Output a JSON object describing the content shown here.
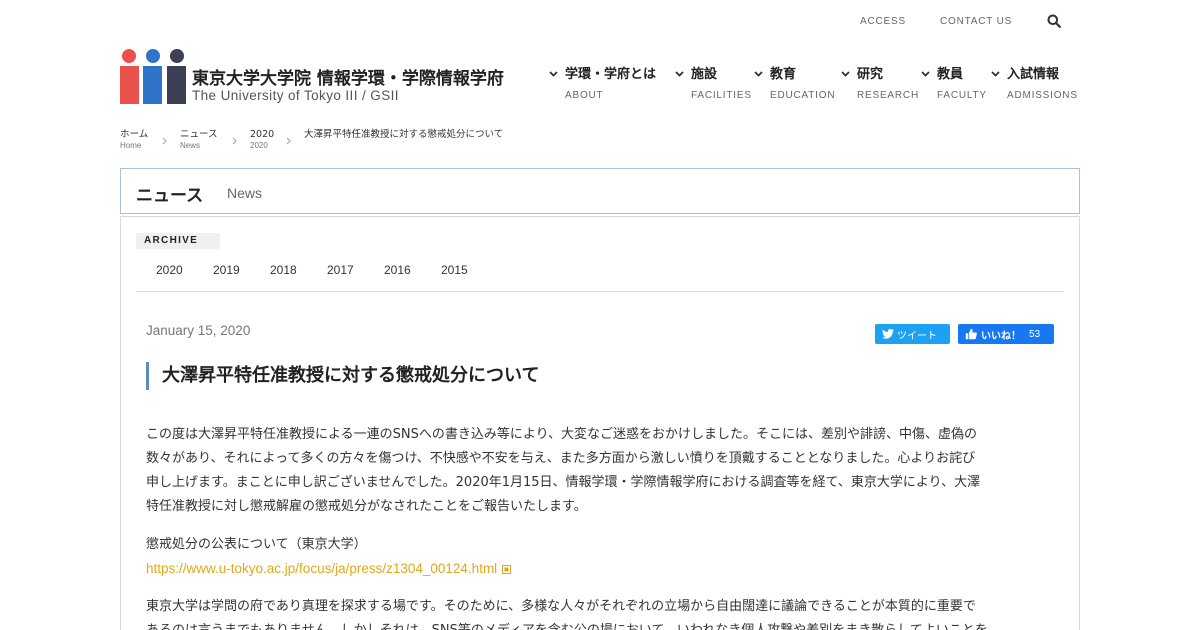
{
  "header": {
    "links": {
      "access": "ACCESS",
      "contact": "CONTACT US"
    },
    "site_title": "東京大学大学院 情報学環・学際情報学府",
    "site_subtitle": "The University of Tokyo III / GSII",
    "logo_colors": [
      "#e8524a",
      "#2e74c9",
      "#3d3f55"
    ]
  },
  "nav": [
    {
      "jp": "学環・学府とは",
      "en": "ABOUT"
    },
    {
      "jp": "施設",
      "en": "FACILITIES"
    },
    {
      "jp": "教育",
      "en": "EDUCATION"
    },
    {
      "jp": "研究",
      "en": "RESEARCH"
    },
    {
      "jp": "教員",
      "en": "FACULTY"
    },
    {
      "jp": "入試情報",
      "en": "ADMISSIONS"
    }
  ],
  "breadcrumb": [
    {
      "jp": "ホーム",
      "en": "Home"
    },
    {
      "jp": "ニュース",
      "en": "News"
    },
    {
      "jp": "2020",
      "en": "2020"
    },
    {
      "jp": "大澤昇平特任准教授に対する懲戒処分について",
      "en": ""
    }
  ],
  "section": {
    "title_jp": "ニュース",
    "title_en": "News"
  },
  "archive": {
    "label": "ARCHIVE",
    "years": [
      "2020",
      "2019",
      "2018",
      "2017",
      "2016",
      "2015"
    ]
  },
  "post": {
    "date": "January 15, 2020",
    "tweet_label": "ツイート",
    "like_label": "いいね！",
    "like_count": "53",
    "title": "大澤昇平特任准教授に対する懲戒処分について",
    "paragraph1_lines": [
      "この度は大澤昇平特任准教授による一連のSNSへの書き込み等により、大変なご迷惑をおかけしました。そこには、差別や誹謗、中傷、虚偽の",
      "数々があり、それによって多くの方々を傷つけ、不快感や不安を与え、また多方面から激しい憤りを頂戴することとなりました。心よりお詫び",
      "申し上げます。まことに申し訳ございませんでした。2020年1月15日、情報学環・学際情報学府における調査等を経て、東京大学により、大澤",
      "特任准教授に対し懲戒解雇の懲戒処分がなされたことをご報告いたします。"
    ],
    "announcement_label": "懲戒処分の公表について（東京大学）",
    "announcement_url": "https://www.u-tokyo.ac.jp/focus/ja/press/z1304_00124.html",
    "paragraph3_lines": [
      "東京大学は学問の府であり真理を探求する場です。そのために、多様な人々がそれぞれの立場から自由闊達に議論できることが本質的に重要で",
      "あるのは言うまでもありません。しかしそれは、SNS等のメディアを含む公の場において、いわれなき個人攻撃や差別をまき散らしてよいことを"
    ],
    "colors": {
      "accent_bar": "#5a8ec0",
      "link": "#e0a81c",
      "tweet": "#1da1f2",
      "like": "#1877f2"
    }
  }
}
